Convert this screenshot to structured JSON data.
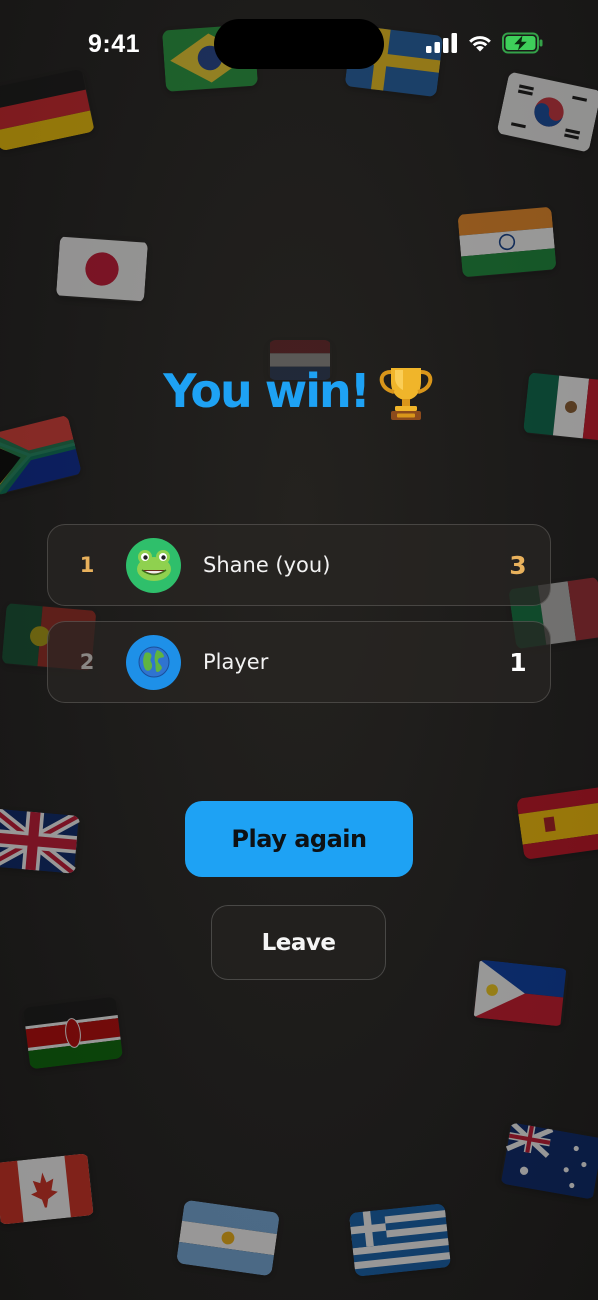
{
  "status_bar": {
    "time": "9:41",
    "icons": [
      "signal-icon",
      "wifi-icon",
      "battery-charging-icon"
    ]
  },
  "title": {
    "text": "You win!",
    "icon": "trophy-icon"
  },
  "leaderboard": [
    {
      "rank": "1",
      "avatar": "frog-avatar",
      "name": "Shane (you)",
      "score": "3",
      "rank_color": "#e8b15c",
      "score_color": "#e8b15c"
    },
    {
      "rank": "2",
      "avatar": "globe-avatar",
      "name": "Player",
      "score": "1",
      "rank_color": "#8a8784",
      "score_color": "#ffffff"
    }
  ],
  "buttons": {
    "play_again": "Play again",
    "leave": "Leave"
  },
  "colors": {
    "accent": "#1ea2f4",
    "background": "#1c1b1a",
    "gold": "#e8b15c",
    "battery_green": "#3ecf5a"
  },
  "background_flags": [
    "brazil-flag",
    "sweden-flag",
    "germany-flag",
    "south-korea-flag",
    "japan-flag",
    "india-flag",
    "netherlands-flag",
    "mexico-flag",
    "south-africa-flag",
    "portugal-flag",
    "italy-flag",
    "uk-flag",
    "spain-flag",
    "philippines-flag",
    "kenya-flag",
    "australia-flag",
    "canada-flag",
    "argentina-flag",
    "greece-flag"
  ]
}
